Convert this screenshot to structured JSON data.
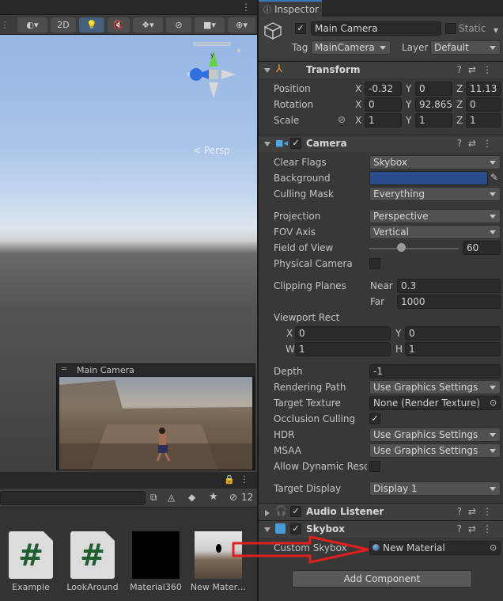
{
  "scene": {
    "toolbar": {
      "mode_2d": "2D"
    },
    "persp_label": "< Persp",
    "gizmo_axes": {
      "y": "y",
      "x": "x"
    },
    "camera_preview_title": "Main Camera"
  },
  "project": {
    "filter_count": "12",
    "assets": [
      {
        "label": "Example",
        "type": "script",
        "glyph": "#"
      },
      {
        "label": "LookAround",
        "type": "script",
        "glyph": "#"
      },
      {
        "label": "Material360",
        "type": "material"
      },
      {
        "label": "New Mater…",
        "type": "material-sky"
      }
    ]
  },
  "inspector": {
    "tab_label": "Inspector",
    "object": {
      "name": "Main Camera",
      "static_label": "Static",
      "tag_label": "Tag",
      "tag_value": "MainCamera",
      "layer_label": "Layer",
      "layer_value": "Default"
    },
    "transform": {
      "title": "Transform",
      "position_label": "Position",
      "rotation_label": "Rotation",
      "scale_label": "Scale",
      "position": {
        "x": "-0.32",
        "y": "0",
        "z": "11.13"
      },
      "rotation": {
        "x": "0",
        "y": "92.865",
        "z": "0"
      },
      "scale": {
        "x": "1",
        "y": "1",
        "z": "1"
      },
      "axes": {
        "x": "X",
        "y": "Y",
        "z": "Z"
      }
    },
    "camera": {
      "title": "Camera",
      "clear_flags_label": "Clear Flags",
      "clear_flags": "Skybox",
      "background_label": "Background",
      "background_color": "#2b4c8c",
      "culling_mask_label": "Culling Mask",
      "culling_mask": "Everything",
      "projection_label": "Projection",
      "projection": "Perspective",
      "fov_axis_label": "FOV Axis",
      "fov_axis": "Vertical",
      "fov_label": "Field of View",
      "fov": "60",
      "fov_slider_fraction": 0.36,
      "physical_camera_label": "Physical Camera",
      "clipping_label": "Clipping Planes",
      "near_label": "Near",
      "near": "0.3",
      "far_label": "Far",
      "far": "1000",
      "viewport_label": "Viewport Rect",
      "vp_x_label": "X",
      "vp_x": "0",
      "vp_y_label": "Y",
      "vp_y": "0",
      "vp_w_label": "W",
      "vp_w": "1",
      "vp_h_label": "H",
      "vp_h": "1",
      "depth_label": "Depth",
      "depth": "-1",
      "rendering_path_label": "Rendering Path",
      "rendering_path": "Use Graphics Settings",
      "target_texture_label": "Target Texture",
      "target_texture": "None (Render Texture)",
      "occlusion_label": "Occlusion Culling",
      "hdr_label": "HDR",
      "hdr": "Use Graphics Settings",
      "msaa_label": "MSAA",
      "msaa": "Use Graphics Settings",
      "dynamic_res_label": "Allow Dynamic Resol",
      "target_display_label": "Target Display",
      "target_display": "Display 1"
    },
    "audio_listener": {
      "title": "Audio Listener"
    },
    "skybox": {
      "title": "Skybox",
      "custom_label": "Custom Skybox",
      "custom_value": "New Material"
    },
    "add_component": "Add Component"
  },
  "colors": {
    "accent": "#3a79bb",
    "arrow": "#e0201e"
  }
}
